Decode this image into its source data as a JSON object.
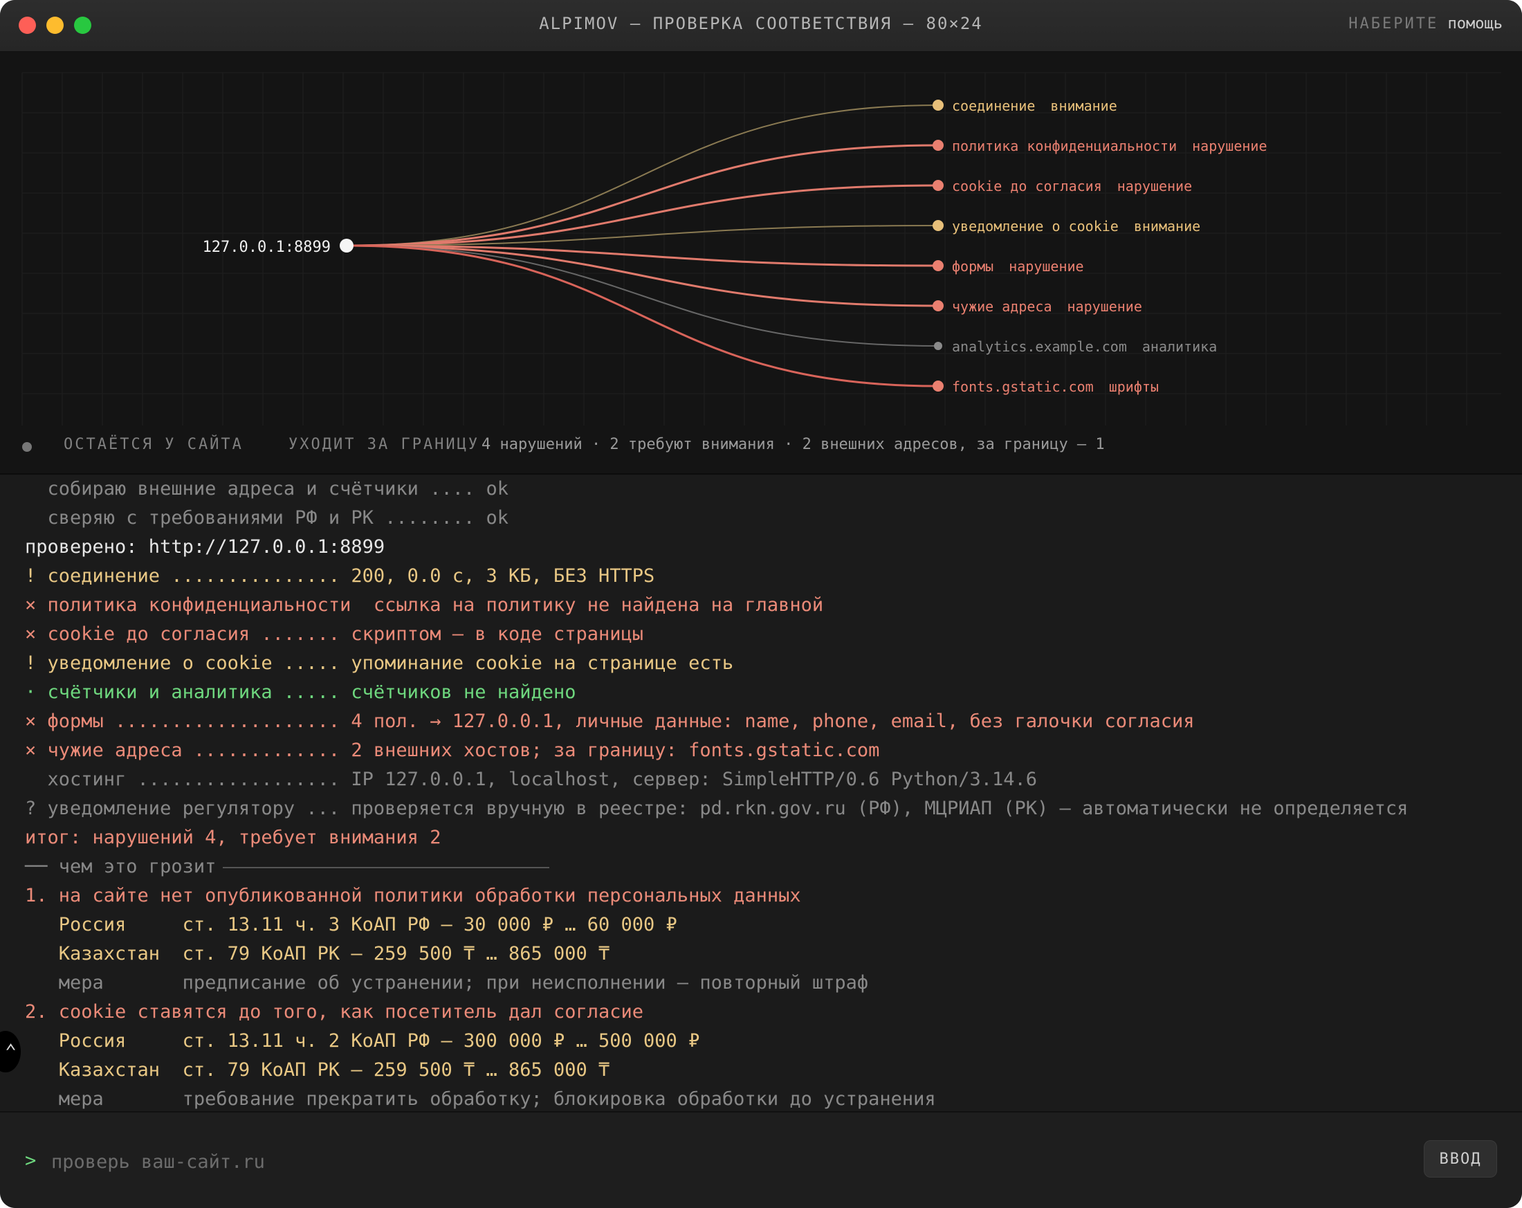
{
  "window": {
    "title": "ALPIMOV — ПРОВЕРКА СООТВЕТСТВИЯ — 80×24",
    "hint_key": "НАБЕРИТЕ",
    "hint_value": "помощь"
  },
  "graph": {
    "root": {
      "label": "127.0.0.1:8899"
    },
    "branches": [
      {
        "name": "соединение",
        "status": "внимание",
        "color": "#e8c07a",
        "line_color": "#8a7a52"
      },
      {
        "name": "политика конфиденциальности",
        "status": "нарушение",
        "color": "#ea8070",
        "line_color": "#e07a6c"
      },
      {
        "name": "cookie до согласия",
        "status": "нарушение",
        "color": "#ea8070",
        "line_color": "#e07a6c"
      },
      {
        "name": "уведомление о cookie",
        "status": "внимание",
        "color": "#e8c07a",
        "line_color": "#8a7a52"
      },
      {
        "name": "формы",
        "status": "нарушение",
        "color": "#ea8070",
        "line_color": "#e07a6c"
      },
      {
        "name": "чужие адреса",
        "status": "нарушение",
        "color": "#ea8070",
        "line_color": "#e07a6c"
      },
      {
        "name": "analytics.example.com",
        "status": "аналитика",
        "color": "#8a8a8a",
        "line_color": "#666666"
      },
      {
        "name": "fonts.gstatic.com",
        "status": "шрифты",
        "color": "#ea8070",
        "line_color": "#d8645a"
      }
    ],
    "legend": {
      "stays": "ОСТАЁТСЯ У САЙТА",
      "leaves": "УХОДИТ ЗА ГРАНИЦУ",
      "stats": "4 нарушений · 2 требуют внимания · 2 внешних адресов, за границу — 1"
    }
  },
  "log": {
    "l01": "  собираю внешние адреса и счётчики .... ok",
    "l02": "  сверяю с требованиями РФ и РК ........ ok",
    "l03": "проверено: http://127.0.0.1:8899",
    "l04": "! соединение ............... 200, 0.0 с, 3 КБ, БЕЗ HTTPS",
    "l05": "× политика конфиденциальности  ссылка на политику не найдена на главной",
    "l06": "× cookie до согласия ....... скриптом — в коде страницы",
    "l07": "! уведомление о cookie ..... упоминание cookie на странице есть",
    "l08a": "· счётчики и аналитика ..... ",
    "l08b": "счётчиков не найдено",
    "l09": "× формы .................... 4 пол. → 127.0.0.1, личные данные: name, phone, email, без галочки согласия",
    "l10": "× чужие адреса ............. 2 внешних хостов; за границу: fonts.gstatic.com",
    "l11": "  хостинг .................. IP 127.0.0.1, localhost, сервер: SimpleHTTP/0.6 Python/3.14.6",
    "l12": "? уведомление регулятору ... проверяется вручную в реестре: pd.rkn.gov.ru (РФ), МЦРИАП (РК) — автоматически не определяется",
    "l13": "итог: нарушений 4, требует внимания 2",
    "l14": "── чем это грозит",
    "l15": "1. на сайте нет опубликованной политики обработки персональных данных",
    "l16": "   Россия     ст. 13.11 ч. 3 КоАП РФ — 30 000 ₽ … 60 000 ₽",
    "l17": "   Казахстан  ст. 79 КоАП РК — 259 500 ₸ … 865 000 ₸",
    "l18": "   мера       предписание об устранении; при неисполнении — повторный штраф",
    "l19": "2. cookie ставятся до того, как посетитель дал согласие",
    "l20": "   Россия     ст. 13.11 ч. 2 КоАП РФ — 300 000 ₽ … 500 000 ₽",
    "l21": "   Казахстан  ст. 79 КоАП РК — 259 500 ₸ … 865 000 ₸",
    "l22": "   мера       требование прекратить обработку; блокировка обработки до устранения"
  },
  "input": {
    "prompt": ">",
    "placeholder": "проверь ваш-сайт.ru",
    "enter_label": "ВВОД"
  }
}
